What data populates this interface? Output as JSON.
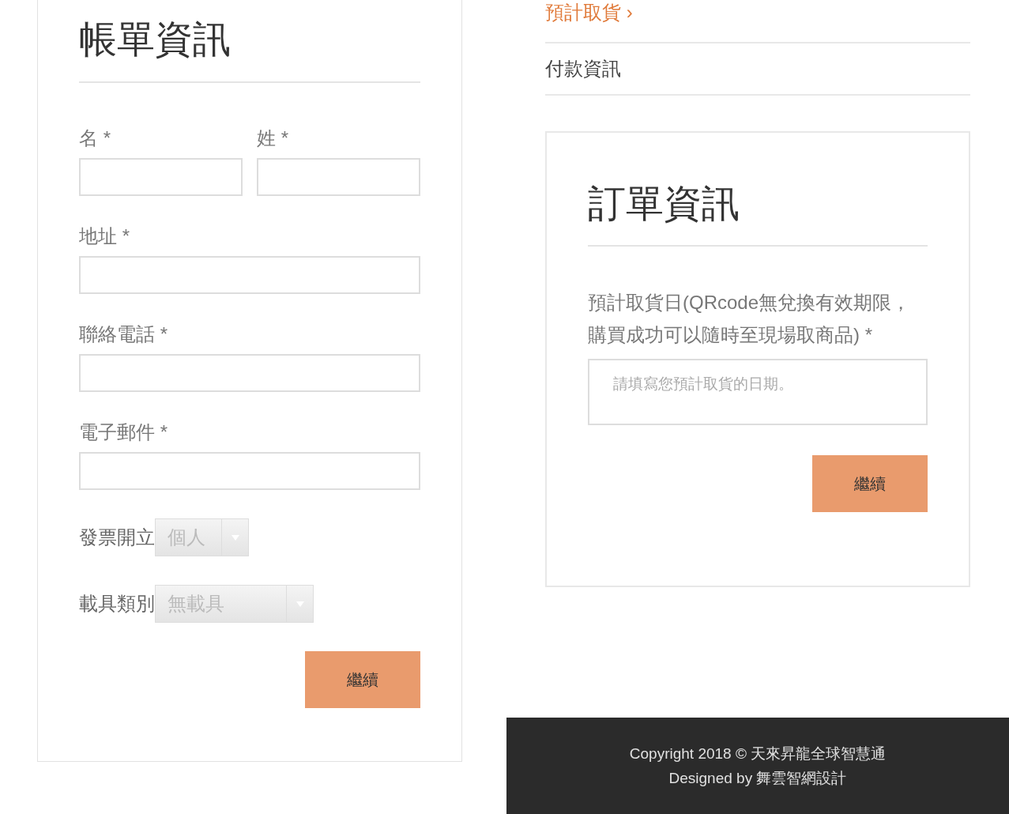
{
  "billing": {
    "title": "帳單資訊",
    "fields": [
      {
        "kind": "half",
        "label": "名 *"
      },
      {
        "kind": "half",
        "label": "姓 *"
      },
      {
        "kind": "full",
        "label": "地址 *"
      },
      {
        "kind": "full",
        "label": "聯絡電話 *"
      },
      {
        "kind": "full",
        "label": "電子郵件 *"
      },
      {
        "kind": "select",
        "label": "發票開立",
        "value": "個人"
      },
      {
        "kind": "select",
        "label": "載具類別",
        "value": "無載具"
      }
    ],
    "button": "繼續"
  },
  "steps": [
    {
      "label": "預計取貨 ›",
      "selected": true
    },
    {
      "label": "付款資訊",
      "selected": false
    }
  ],
  "order": {
    "title": "訂單資訊",
    "label": "預計取貨日(QRcode無兌換有效期限，購買成功可以隨時至現場取商品) *",
    "placeholder": "請填寫您預計取貨的日期。",
    "button": "繼續"
  },
  "footer": [
    "Copyright 2018 © 天來昇龍全球智慧通",
    "Designed by 舞雲智網設計"
  ]
}
